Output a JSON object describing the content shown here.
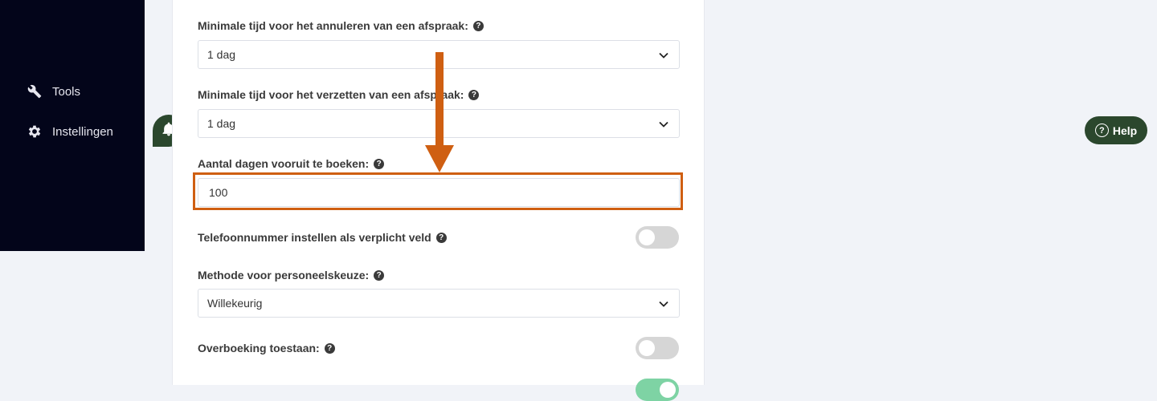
{
  "sidebar": {
    "items": [
      {
        "label": "Tools",
        "icon": "wrench-icon"
      },
      {
        "label": "Instellingen",
        "icon": "gear-icon"
      }
    ]
  },
  "notification": {
    "icon": "bell-icon"
  },
  "settings": {
    "cancel_time": {
      "label": "Minimale tijd voor het annuleren van een afspraak:",
      "value": "1 dag"
    },
    "reschedule_time": {
      "label": "Minimale tijd voor het verzetten van een afspraak:",
      "value": "1 dag"
    },
    "days_ahead": {
      "label": "Aantal dagen vooruit te boeken:",
      "value": "100"
    },
    "phone_required": {
      "label": "Telefoonnummer instellen als verplicht veld",
      "enabled": false
    },
    "staff_method": {
      "label": "Methode voor personeelskeuze:",
      "value": "Willekeurig"
    },
    "overbooking": {
      "label": "Overboeking toestaan:",
      "enabled": false
    },
    "last_toggle": {
      "enabled": true
    }
  },
  "help_button": {
    "label": "Help"
  },
  "colors": {
    "sidebar_bg": "#03051a",
    "accent_green": "#2b472d",
    "annotation_orange": "#cf5f12",
    "toggle_on": "#7ed3a4",
    "toggle_off": "#d6d6d6"
  }
}
